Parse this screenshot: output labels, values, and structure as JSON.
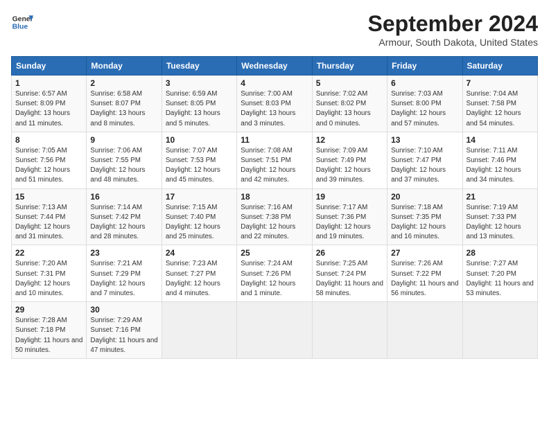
{
  "header": {
    "logo_line1": "General",
    "logo_line2": "Blue",
    "title": "September 2024",
    "location": "Armour, South Dakota, United States"
  },
  "weekdays": [
    "Sunday",
    "Monday",
    "Tuesday",
    "Wednesday",
    "Thursday",
    "Friday",
    "Saturday"
  ],
  "weeks": [
    [
      {
        "day": "1",
        "sunrise": "Sunrise: 6:57 AM",
        "sunset": "Sunset: 8:09 PM",
        "daylight": "Daylight: 13 hours and 11 minutes."
      },
      {
        "day": "2",
        "sunrise": "Sunrise: 6:58 AM",
        "sunset": "Sunset: 8:07 PM",
        "daylight": "Daylight: 13 hours and 8 minutes."
      },
      {
        "day": "3",
        "sunrise": "Sunrise: 6:59 AM",
        "sunset": "Sunset: 8:05 PM",
        "daylight": "Daylight: 13 hours and 5 minutes."
      },
      {
        "day": "4",
        "sunrise": "Sunrise: 7:00 AM",
        "sunset": "Sunset: 8:03 PM",
        "daylight": "Daylight: 13 hours and 3 minutes."
      },
      {
        "day": "5",
        "sunrise": "Sunrise: 7:02 AM",
        "sunset": "Sunset: 8:02 PM",
        "daylight": "Daylight: 13 hours and 0 minutes."
      },
      {
        "day": "6",
        "sunrise": "Sunrise: 7:03 AM",
        "sunset": "Sunset: 8:00 PM",
        "daylight": "Daylight: 12 hours and 57 minutes."
      },
      {
        "day": "7",
        "sunrise": "Sunrise: 7:04 AM",
        "sunset": "Sunset: 7:58 PM",
        "daylight": "Daylight: 12 hours and 54 minutes."
      }
    ],
    [
      {
        "day": "8",
        "sunrise": "Sunrise: 7:05 AM",
        "sunset": "Sunset: 7:56 PM",
        "daylight": "Daylight: 12 hours and 51 minutes."
      },
      {
        "day": "9",
        "sunrise": "Sunrise: 7:06 AM",
        "sunset": "Sunset: 7:55 PM",
        "daylight": "Daylight: 12 hours and 48 minutes."
      },
      {
        "day": "10",
        "sunrise": "Sunrise: 7:07 AM",
        "sunset": "Sunset: 7:53 PM",
        "daylight": "Daylight: 12 hours and 45 minutes."
      },
      {
        "day": "11",
        "sunrise": "Sunrise: 7:08 AM",
        "sunset": "Sunset: 7:51 PM",
        "daylight": "Daylight: 12 hours and 42 minutes."
      },
      {
        "day": "12",
        "sunrise": "Sunrise: 7:09 AM",
        "sunset": "Sunset: 7:49 PM",
        "daylight": "Daylight: 12 hours and 39 minutes."
      },
      {
        "day": "13",
        "sunrise": "Sunrise: 7:10 AM",
        "sunset": "Sunset: 7:47 PM",
        "daylight": "Daylight: 12 hours and 37 minutes."
      },
      {
        "day": "14",
        "sunrise": "Sunrise: 7:11 AM",
        "sunset": "Sunset: 7:46 PM",
        "daylight": "Daylight: 12 hours and 34 minutes."
      }
    ],
    [
      {
        "day": "15",
        "sunrise": "Sunrise: 7:13 AM",
        "sunset": "Sunset: 7:44 PM",
        "daylight": "Daylight: 12 hours and 31 minutes."
      },
      {
        "day": "16",
        "sunrise": "Sunrise: 7:14 AM",
        "sunset": "Sunset: 7:42 PM",
        "daylight": "Daylight: 12 hours and 28 minutes."
      },
      {
        "day": "17",
        "sunrise": "Sunrise: 7:15 AM",
        "sunset": "Sunset: 7:40 PM",
        "daylight": "Daylight: 12 hours and 25 minutes."
      },
      {
        "day": "18",
        "sunrise": "Sunrise: 7:16 AM",
        "sunset": "Sunset: 7:38 PM",
        "daylight": "Daylight: 12 hours and 22 minutes."
      },
      {
        "day": "19",
        "sunrise": "Sunrise: 7:17 AM",
        "sunset": "Sunset: 7:36 PM",
        "daylight": "Daylight: 12 hours and 19 minutes."
      },
      {
        "day": "20",
        "sunrise": "Sunrise: 7:18 AM",
        "sunset": "Sunset: 7:35 PM",
        "daylight": "Daylight: 12 hours and 16 minutes."
      },
      {
        "day": "21",
        "sunrise": "Sunrise: 7:19 AM",
        "sunset": "Sunset: 7:33 PM",
        "daylight": "Daylight: 12 hours and 13 minutes."
      }
    ],
    [
      {
        "day": "22",
        "sunrise": "Sunrise: 7:20 AM",
        "sunset": "Sunset: 7:31 PM",
        "daylight": "Daylight: 12 hours and 10 minutes."
      },
      {
        "day": "23",
        "sunrise": "Sunrise: 7:21 AM",
        "sunset": "Sunset: 7:29 PM",
        "daylight": "Daylight: 12 hours and 7 minutes."
      },
      {
        "day": "24",
        "sunrise": "Sunrise: 7:23 AM",
        "sunset": "Sunset: 7:27 PM",
        "daylight": "Daylight: 12 hours and 4 minutes."
      },
      {
        "day": "25",
        "sunrise": "Sunrise: 7:24 AM",
        "sunset": "Sunset: 7:26 PM",
        "daylight": "Daylight: 12 hours and 1 minute."
      },
      {
        "day": "26",
        "sunrise": "Sunrise: 7:25 AM",
        "sunset": "Sunset: 7:24 PM",
        "daylight": "Daylight: 11 hours and 58 minutes."
      },
      {
        "day": "27",
        "sunrise": "Sunrise: 7:26 AM",
        "sunset": "Sunset: 7:22 PM",
        "daylight": "Daylight: 11 hours and 56 minutes."
      },
      {
        "day": "28",
        "sunrise": "Sunrise: 7:27 AM",
        "sunset": "Sunset: 7:20 PM",
        "daylight": "Daylight: 11 hours and 53 minutes."
      }
    ],
    [
      {
        "day": "29",
        "sunrise": "Sunrise: 7:28 AM",
        "sunset": "Sunset: 7:18 PM",
        "daylight": "Daylight: 11 hours and 50 minutes."
      },
      {
        "day": "30",
        "sunrise": "Sunrise: 7:29 AM",
        "sunset": "Sunset: 7:16 PM",
        "daylight": "Daylight: 11 hours and 47 minutes."
      },
      null,
      null,
      null,
      null,
      null
    ]
  ]
}
